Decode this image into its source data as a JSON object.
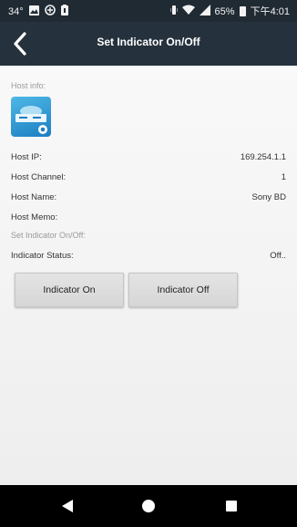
{
  "status_bar": {
    "temperature": "34°",
    "battery_percent": "65%",
    "time": "下午4:01",
    "icons": [
      "image-icon",
      "app-icon",
      "notification-icon",
      "vibrate-icon",
      "wifi-icon",
      "signal-icon",
      "battery-icon"
    ]
  },
  "header": {
    "title": "Set Indicator On/Off",
    "back_icon": "chevron-left-icon"
  },
  "host_info": {
    "section_label": "Host info:",
    "logo_icon": "blu-ray-player-icon",
    "rows": [
      {
        "label": "Host IP:",
        "value": "169.254.1.1"
      },
      {
        "label": "Host Channel:",
        "value": "1"
      },
      {
        "label": "Host Name:",
        "value": "Sony BD"
      },
      {
        "label": "Host Memo:",
        "value": ""
      }
    ]
  },
  "indicator": {
    "section_label": "Set Indicator On/Off:",
    "status_label": "Indicator Status:",
    "status_value": "Off..",
    "on_button": "Indicator On",
    "off_button": "Indicator Off"
  },
  "nav_bar": {
    "icons": [
      "back-triangle-icon",
      "home-circle-icon",
      "recents-square-icon"
    ]
  },
  "colors": {
    "status_bar_bg": "#202a33",
    "header_bg": "#25313d",
    "content_bg": "#f4f4f4",
    "button_bg": "#dcdcdc",
    "nav_bar_bg": "#000000"
  }
}
